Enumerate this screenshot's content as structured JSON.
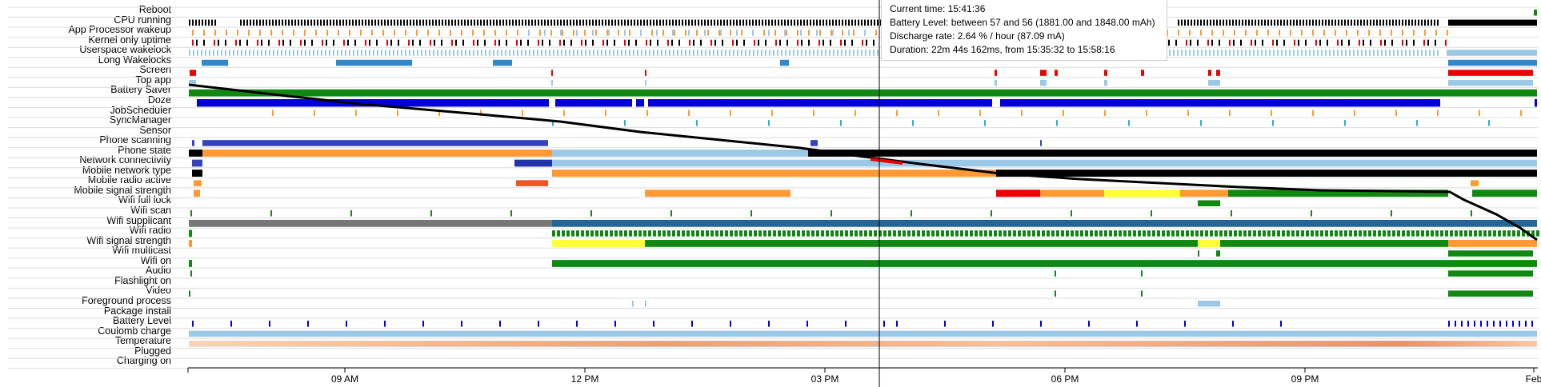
{
  "rows": [
    "Reboot",
    "CPU running",
    "App Processor wakeup",
    "Kernel only uptime",
    "Userspace wakelock",
    "Long Wakelocks",
    "Screen",
    "Top app",
    "Battery Saver",
    "Doze",
    "JobScheduler",
    "SyncManager",
    "Sensor",
    "Phone scanning",
    "Phone state",
    "Network connectivity",
    "Mobile network type",
    "Mobile radio active",
    "Mobile signal strength",
    "Wifi full lock",
    "Wifi scan",
    "Wifi supplicant",
    "Wifi radio",
    "Wifi signal strength",
    "Wifi multicast",
    "Wifi on",
    "Audio",
    "Flashlight on",
    "Video",
    "Foreground process",
    "Package install",
    "Battery Level",
    "Coulomb charge",
    "Temperature",
    "Plugged",
    "Charging on"
  ],
  "axis": {
    "ticks": [
      "09 AM",
      "12 PM",
      "03 PM",
      "06 PM",
      "09 PM",
      "Feb"
    ]
  },
  "tooltip": {
    "current_time": "Current time: 15:41:36",
    "battery_level": "Battery Level: between 57 and 56 (1881.00 and 1848.00 mAh)",
    "discharge_rate": "Discharge rate: 2.64 % / hour (87.09 mA)",
    "duration": "Duration: 22m 44s 162ms, from 15:35:32 to 15:58:16"
  },
  "colors": {
    "black": "#000000",
    "blue": "#0000dd",
    "light_blue": "#9cc8e8",
    "green": "#118811",
    "orange": "#ff9933",
    "red": "#ee0000",
    "yellow": "#ffff33",
    "gray": "#777777",
    "grid": "#dddddd"
  }
}
